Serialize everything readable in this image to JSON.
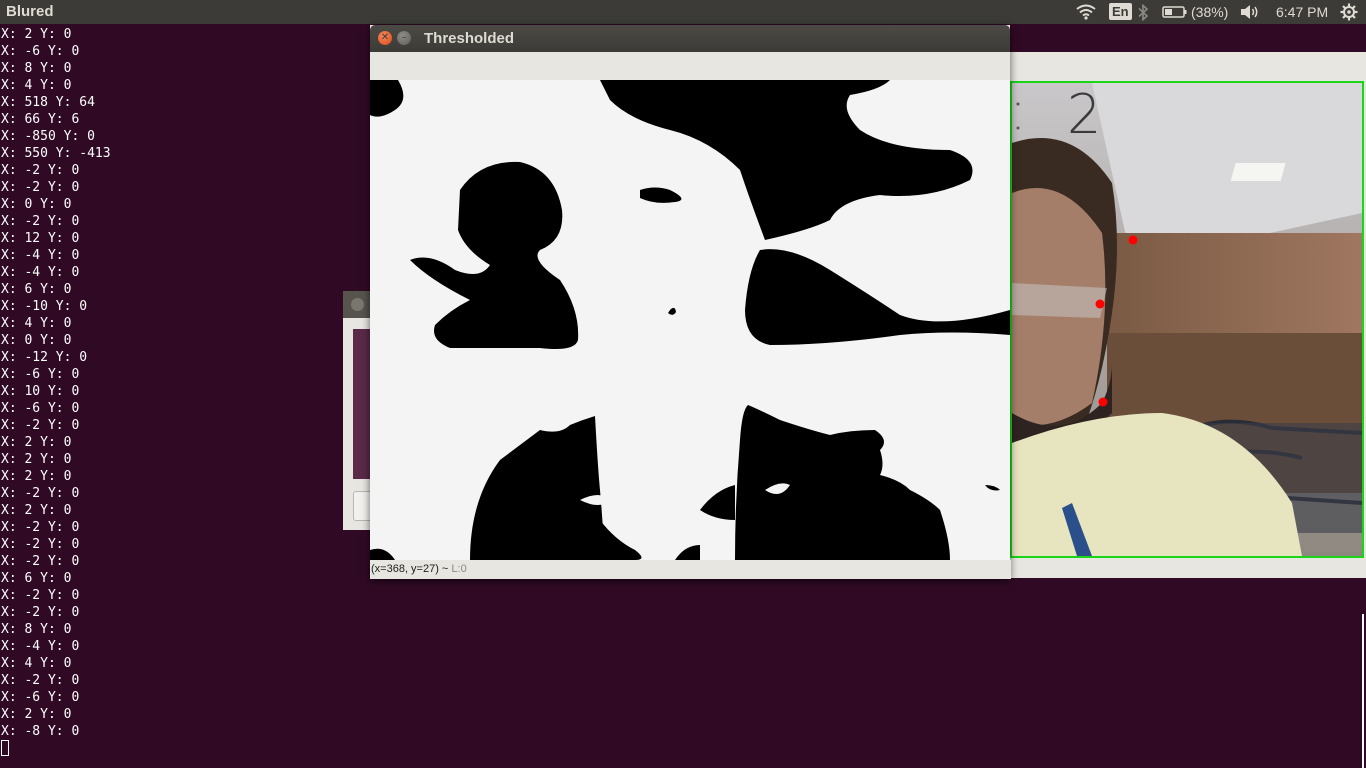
{
  "panel": {
    "app_title": "Blured",
    "lang": "En",
    "battery": "(38%)",
    "time": "6:47 PM"
  },
  "terminal": {
    "lines": [
      "X: 2 Y: 0",
      "X: -6 Y: 0",
      "X: 8 Y: 0",
      "X: 4 Y: 0",
      "X: 518 Y: 64",
      "X: 66 Y: 6",
      "X: -850 Y: 0",
      "X: 550 Y: -413",
      "X: -2 Y: 0",
      "X: -2 Y: 0",
      "X: 0 Y: 0",
      "X: -2 Y: 0",
      "X: 12 Y: 0",
      "X: -4 Y: 0",
      "X: -4 Y: 0",
      "X: 6 Y: 0",
      "X: -10 Y: 0",
      "X: 4 Y: 0",
      "X: 0 Y: 0",
      "X: -12 Y: 0",
      "X: -6 Y: 0",
      "X: 10 Y: 0",
      "X: -6 Y: 0",
      "X: -2 Y: 0",
      "X: 2 Y: 0",
      "X: 2 Y: 0",
      "X: 2 Y: 0",
      "X: -2 Y: 0",
      "X: 2 Y: 0",
      "X: -2 Y: 0",
      "X: -2 Y: 0",
      "X: -2 Y: 0",
      "X: 6 Y: 0",
      "X: -2 Y: 0",
      "X: -2 Y: 0",
      "X: 8 Y: 0",
      "X: -4 Y: 0",
      "X: 4 Y: 0",
      "X: -2 Y: 0",
      "X: -6 Y: 0",
      "X: 2 Y: 0",
      "X: -8 Y: 0"
    ]
  },
  "thresholded": {
    "title": "Thresholded",
    "status_coords": "(x=368, y=27) ~",
    "status_value": "L:0"
  },
  "blured": {
    "overlay_number": "2"
  },
  "colors": {
    "terminal_bg": "#300a24",
    "panel_bg": "#3c3b37",
    "close_button": "#dd4814",
    "camera_border": "#19d619",
    "tracking_dot": "#ff0000"
  }
}
